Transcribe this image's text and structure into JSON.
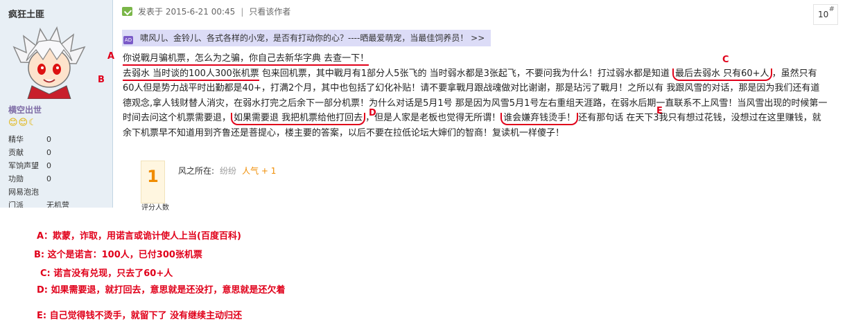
{
  "author": {
    "name": "疯狂土匪",
    "rank": "横空出世",
    "stars": "😊😊☾",
    "stats": [
      {
        "label": "精华",
        "value": "0"
      },
      {
        "label": "贡献",
        "value": "0"
      },
      {
        "label": "军饷声望",
        "value": "0"
      },
      {
        "label": "功勋",
        "value": "0"
      },
      {
        "label": "网易泡泡",
        "value": ""
      },
      {
        "label": "门派",
        "value": "无机营"
      }
    ]
  },
  "post": {
    "posted_at": "发表于 2015-6-21 00:45",
    "sep": "|",
    "only_author": "只看该作者",
    "floor": "10",
    "floor_symbol": "#",
    "banner": "啸风儿、金铃儿、各式各样的小宠，是否有打动你的心？----晒最爱萌宠，当最佳饲养员！ >>",
    "ad_label": "AD",
    "p1_u": "你说戰月骗机票，怎么为之骗，你自己去新华字典 去查一下！",
    "p2_u1": "去弱水 当时谈的100人300张机票",
    "p2_t1": " 包来回机票，其中戰月有1部分人5张飞的 当时弱水都是3张起飞，不要问我为什么！打过弱水都是知道 ",
    "p2_u2": "最后去弱水 只有60+人",
    "p2_t2": "，虽然只有60人但是势力战平时出勤都是40+，打满2个月，其中也包括了幻化补贴！请不要拿戰月跟战魂做对比谢谢，那是玷污了戰月！之所以有 我跟风雪的对话，那是因为我们还有道德观念,拿人钱财替人消灾，在弱水打完之后余下一部分机票！为什么对话是5月1号 那是因为风雪5月1号左右重组天涯路，在弱水后期一直联系不上风雪！当风雪出现的时候第一时间去问这个机票需要退，",
    "p2_u3": "如果需要退 我把机票给他打回去",
    "p2_t3": "，但是人家是老板也觉得无所谓！",
    "p2_u4": "谁会嫌弃钱烫手！",
    "p2_t4": "还有那句话 在天下3我只有想过花钱，没想过在这里赚钱，就余下机票早不知道用到齐鲁还是菩提心，楼主要的答案，以后不要在拉低论坛大婶们的智商！复读机一样傻子！",
    "markers": {
      "a": "A",
      "b": "B",
      "c": "C",
      "d": "D",
      "e": "E"
    },
    "rating": {
      "count": "1",
      "count_label": "评分人数",
      "label": "风之所在:",
      "user": "纷纷",
      "popularity": "人气 + 1"
    }
  },
  "annotations": [
    "A：欺蒙，诈取，用诺言或诡计使人上当(百度百科)",
    "B:  这个是诺言：100人，已付300张机票",
    "C:  诺言没有兑现，只去了60+人",
    "D:  如果需要退，就打回去，意思就是还没打，意思就是还欠着",
    "E:  自己觉得钱不烫手，就留下了 没有继续主动归还"
  ],
  "colors": {
    "annotation_red": "#e0001a",
    "sidebar_bg": "#e8eff5",
    "banner_bg": "#dcdcf7",
    "rate_orange": "#f08c00"
  }
}
